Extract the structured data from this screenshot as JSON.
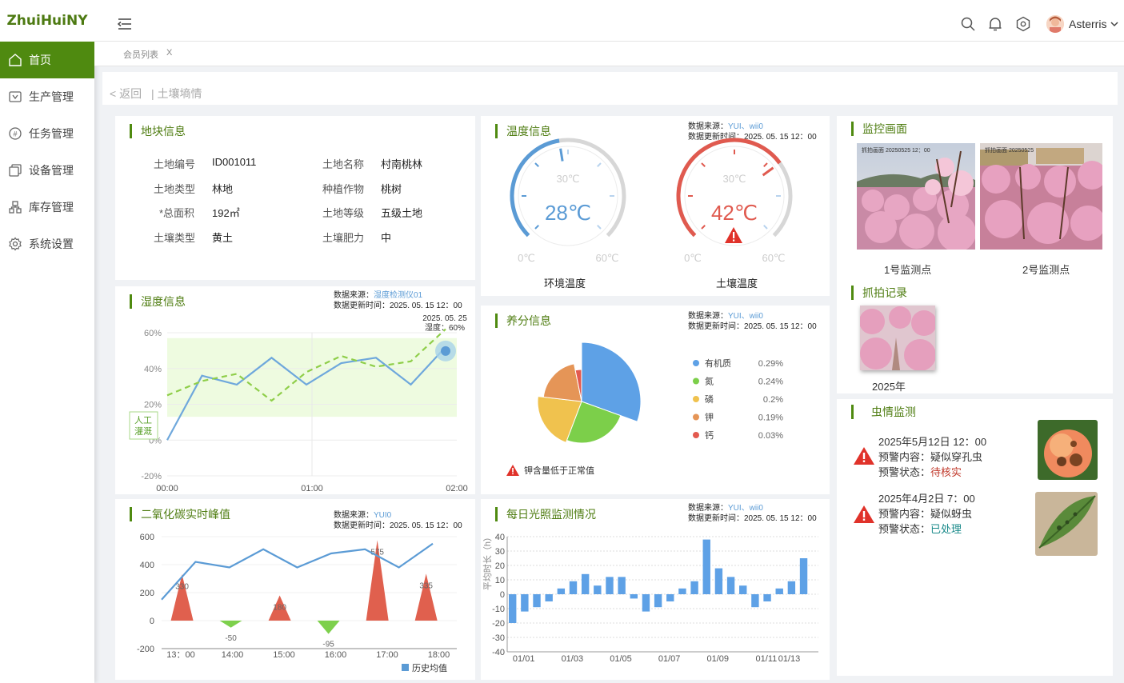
{
  "app": {
    "logo": "ZhuiHuiNY",
    "user_name": "Asterris"
  },
  "sidebar": {
    "items": [
      {
        "label": "首页",
        "icon": "home-icon"
      },
      {
        "label": "生产管理",
        "icon": "production-icon"
      },
      {
        "label": "任务管理",
        "icon": "task-icon"
      },
      {
        "label": "设备管理",
        "icon": "device-icon"
      },
      {
        "label": "库存管理",
        "icon": "inventory-icon"
      },
      {
        "label": "系统设置",
        "icon": "gear-icon"
      }
    ]
  },
  "tabs": {
    "label": "会员列表",
    "close": "X"
  },
  "breadcrumb": {
    "back": "< 返回",
    "sep": "|",
    "current": "土壤墒情"
  },
  "plot_info": {
    "title": "地块信息",
    "fields": [
      {
        "label": "土地编号",
        "value": "ID001011"
      },
      {
        "label": "土地名称",
        "value": "村南桃林"
      },
      {
        "label": "土地类型",
        "value": "林地"
      },
      {
        "label": "种植作物",
        "value": "桃树"
      },
      {
        "label": "*总面积",
        "value": "192㎡"
      },
      {
        "label": "土地等级",
        "value": "五级土地"
      },
      {
        "label": "土壤类型",
        "value": "黄土"
      },
      {
        "label": "土壤肥力",
        "value": "中"
      }
    ]
  },
  "temperature": {
    "title": "温度信息",
    "source_label": "数据来源：",
    "source": "YUI、wii0",
    "update_label": "数据更新时间：",
    "update": "2025. 05. 15 12：00",
    "gauges": [
      {
        "name": "环境温度",
        "value": 28,
        "value_text": "28℃",
        "min": "0℃",
        "mid": "30℃",
        "max": "60℃",
        "color": "#5b9bd5",
        "alert": false
      },
      {
        "name": "土壤温度",
        "value": 42,
        "value_text": "42℃",
        "min": "0℃",
        "mid": "30℃",
        "max": "60℃",
        "color": "#e05a4f",
        "alert": true
      }
    ]
  },
  "monitor": {
    "title": "监控画面",
    "cams": [
      {
        "name": "1号监测点",
        "stamp": "抓拍画面 20250525 12：00"
      },
      {
        "name": "2号监测点",
        "stamp": "抓拍画面 20250525"
      }
    ]
  },
  "snapshot": {
    "title": "抓拍记录",
    "year": "2025年"
  },
  "humidity": {
    "title": "湿度信息",
    "source_label": "数据来源：",
    "source": "湿度检测仪01",
    "update_label": "数据更新时间：",
    "update": "2025. 05. 15 12：00",
    "tooltip_date": "2025. 05. 25",
    "tooltip_value": "湿度：60%",
    "irrigation_label": "人工灌溉"
  },
  "nutrient": {
    "title": "养分信息",
    "source_label": "数据来源：",
    "source": "YUI、wii0",
    "update_label": "数据更新时间：",
    "update": "2025. 05. 15 12：00",
    "warning": "钾含量低于正常值"
  },
  "pest": {
    "title": "虫情监测",
    "items": [
      {
        "time": "2025年5月12日  12：00",
        "content_label": "预警内容：",
        "content": "疑似穿孔虫",
        "status_label": "预警状态：",
        "status": "待核实",
        "status_color": "#c0392b"
      },
      {
        "time": "2025年4月2日  7：00",
        "content_label": "预警内容：",
        "content": "疑似蚜虫",
        "status_label": "预警状态：",
        "status": "已处理",
        "status_color": "#1a8a8a"
      }
    ]
  },
  "co2": {
    "title": "二氧化碳实时峰值",
    "source_label": "数据来源：",
    "source": "YUI0",
    "update_label": "数据更新时间：",
    "update": "2025. 05. 15 12：00"
  },
  "light": {
    "title": "每日光照监测情况",
    "source_label": "数据来源：",
    "source": "YUI、wii0",
    "update_label": "数据更新时间：",
    "update": "2025. 05. 15 12：00"
  },
  "chart_data": [
    {
      "type": "line",
      "x": [
        "00:00",
        "",
        "",
        "",
        "",
        "",
        "01:00",
        "",
        "",
        "",
        "",
        "",
        "02:00"
      ],
      "series": [
        {
          "values": [
            0,
            36,
            31,
            46,
            31,
            43,
            46,
            31,
            52
          ],
          "color": "#6fa8dc",
          "dash": false
        },
        {
          "values": [
            25,
            33,
            37,
            22,
            38,
            47,
            41,
            44,
            62
          ],
          "color": "#8fce4a",
          "dash": true
        }
      ],
      "tick_labels": [
        "00:00",
        "01:00",
        "02:00"
      ],
      "yticks": [
        "60%",
        "40%",
        "20%",
        "0%",
        "-20%"
      ],
      "ylim": [
        -20,
        60
      ],
      "band": [
        13,
        57
      ]
    },
    {
      "type": "pie",
      "series": [
        {
          "name": "有机质",
          "value": 0.29,
          "display": "0.29%",
          "color": "#5ea1e6"
        },
        {
          "name": "氮",
          "value": 0.24,
          "display": "0.24%",
          "color": "#7ccf4a"
        },
        {
          "name": "磷",
          "value": 0.2,
          "display": "0.2%",
          "color": "#f0c24e"
        },
        {
          "name": "钾",
          "value": 0.19,
          "display": "0.19%",
          "color": "#e59557"
        },
        {
          "name": "钙",
          "value": 0.03,
          "display": "0.03%",
          "color": "#e35a4f"
        }
      ]
    },
    {
      "type": "line",
      "x": [
        "13：00",
        "14:00",
        "15:00",
        "16:00",
        "17:00",
        "18:00"
      ],
      "yticks": [
        "600",
        "400",
        "200",
        "0",
        "-200"
      ],
      "ylim": [
        -200,
        600
      ],
      "line": [
        150,
        420,
        380,
        510,
        380,
        480,
        510,
        380,
        550
      ],
      "peaks": [
        {
          "value": 330,
          "label": "330",
          "pos": 0.04
        },
        {
          "value": -50,
          "label": "-50",
          "pos": 0.22
        },
        {
          "value": 180,
          "label": "180",
          "pos": 0.4
        },
        {
          "value": -95,
          "label": "-95",
          "pos": 0.58
        },
        {
          "value": 575,
          "label": "575",
          "pos": 0.76
        },
        {
          "value": 335,
          "label": "335",
          "pos": 0.94
        }
      ],
      "legend": "历史均值"
    },
    {
      "type": "bar",
      "ylabel": "平均时长（h）",
      "yticks": [
        "40",
        "30",
        "20",
        "10",
        "0",
        "-10",
        "-20",
        "-30",
        "-40"
      ],
      "ylim": [
        -40,
        40
      ],
      "xticks": [
        "01/01",
        "01/03",
        "01/05",
        "01/07",
        "01/09",
        "01/11",
        "01/13"
      ],
      "values": [
        -20,
        -12,
        -9,
        -5,
        4,
        9,
        14,
        6,
        12,
        12,
        -3,
        -12,
        -9,
        -5,
        4,
        9,
        38,
        18,
        12,
        6,
        -9,
        -5,
        4,
        9,
        25
      ]
    }
  ]
}
